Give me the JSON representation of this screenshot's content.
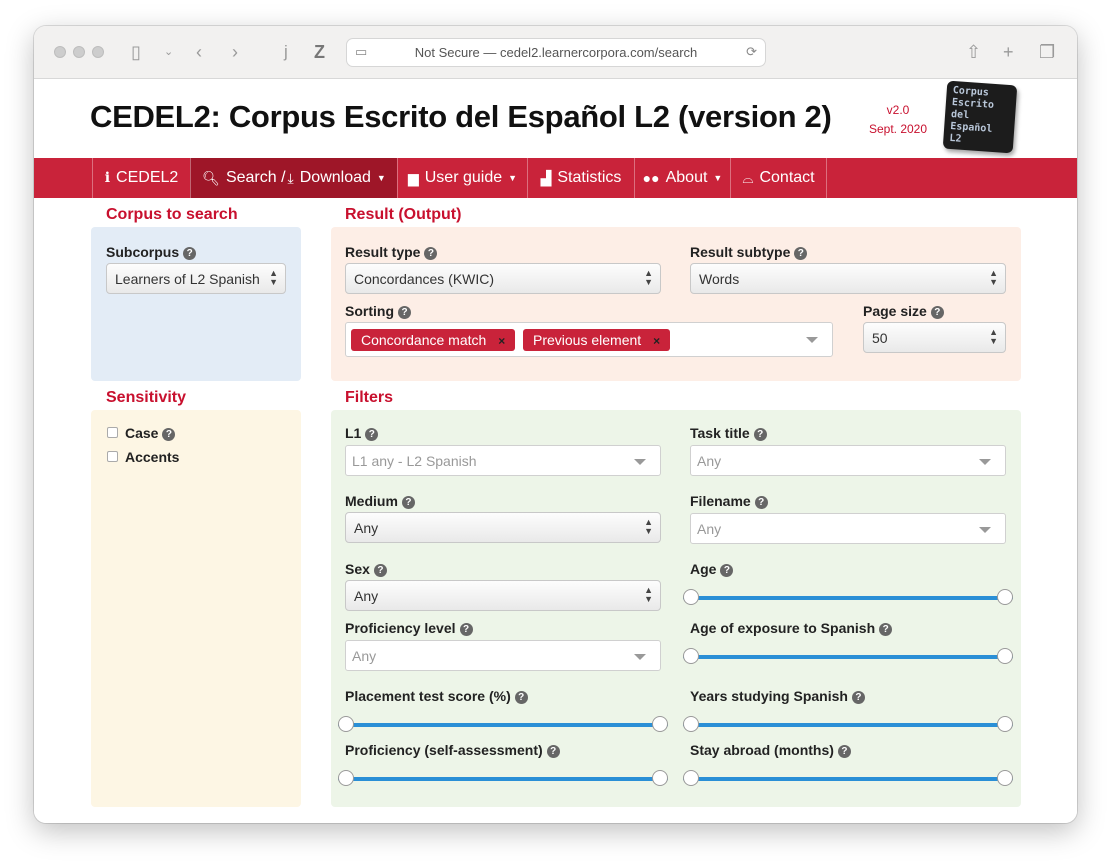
{
  "browser": {
    "address": "Not Secure — cedel2.learnercorpora.com/search"
  },
  "header": {
    "title": "CEDEL2: Corpus Escrito del Español L2 (version 2)",
    "version": "v2.0",
    "version_date": "Sept. 2020",
    "logo_text": [
      "Corpus",
      "Escrito",
      "del",
      "Español",
      "L2"
    ]
  },
  "nav": {
    "items": [
      {
        "label": "CEDEL2",
        "icon": "info-icon"
      },
      {
        "label": "Search / ",
        "label2": "Download",
        "icon": "search-icon",
        "icon2": "download-icon",
        "dropdown": true,
        "active": true
      },
      {
        "label": "User guide",
        "icon": "file-icon",
        "dropdown": true
      },
      {
        "label": "Statistics",
        "icon": "bar-chart-icon"
      },
      {
        "label": "About",
        "icon": "users-icon",
        "dropdown": true
      },
      {
        "label": "Contact",
        "icon": "inbox-icon"
      }
    ],
    "active_color": "#9e1628",
    "brand_color": "#c9233a"
  },
  "corpus": {
    "title": "Corpus to search",
    "subcorpus_label": "Subcorpus",
    "subcorpus_value": "Learners of L2 Spanish"
  },
  "sensitivity": {
    "title": "Sensitivity",
    "options": [
      {
        "label": "Case",
        "checked": false
      },
      {
        "label": "Accents",
        "checked": false
      }
    ]
  },
  "result": {
    "title": "Result (Output)",
    "type_label": "Result type",
    "type_value": "Concordances (KWIC)",
    "subtype_label": "Result subtype",
    "subtype_value": "Words",
    "sorting_label": "Sorting",
    "sorting_tags": [
      "Concordance match",
      "Previous element"
    ],
    "pagesize_label": "Page size",
    "pagesize_value": "50"
  },
  "filters": {
    "title": "Filters",
    "l1_label": "L1",
    "l1_placeholder": "L1 any - L2 Spanish",
    "task_label": "Task title",
    "task_placeholder": "Any",
    "medium_label": "Medium",
    "medium_value": "Any",
    "filename_label": "Filename",
    "filename_placeholder": "Any",
    "sex_label": "Sex",
    "sex_value": "Any",
    "age_label": "Age",
    "prof_label": "Proficiency level",
    "prof_placeholder": "Any",
    "exposure_label": "Age of exposure to Spanish",
    "placement_label": "Placement test score (%)",
    "years_label": "Years studying Spanish",
    "selfassess_label": "Proficiency (self-assessment)",
    "abroad_label": "Stay abroad (months)"
  }
}
